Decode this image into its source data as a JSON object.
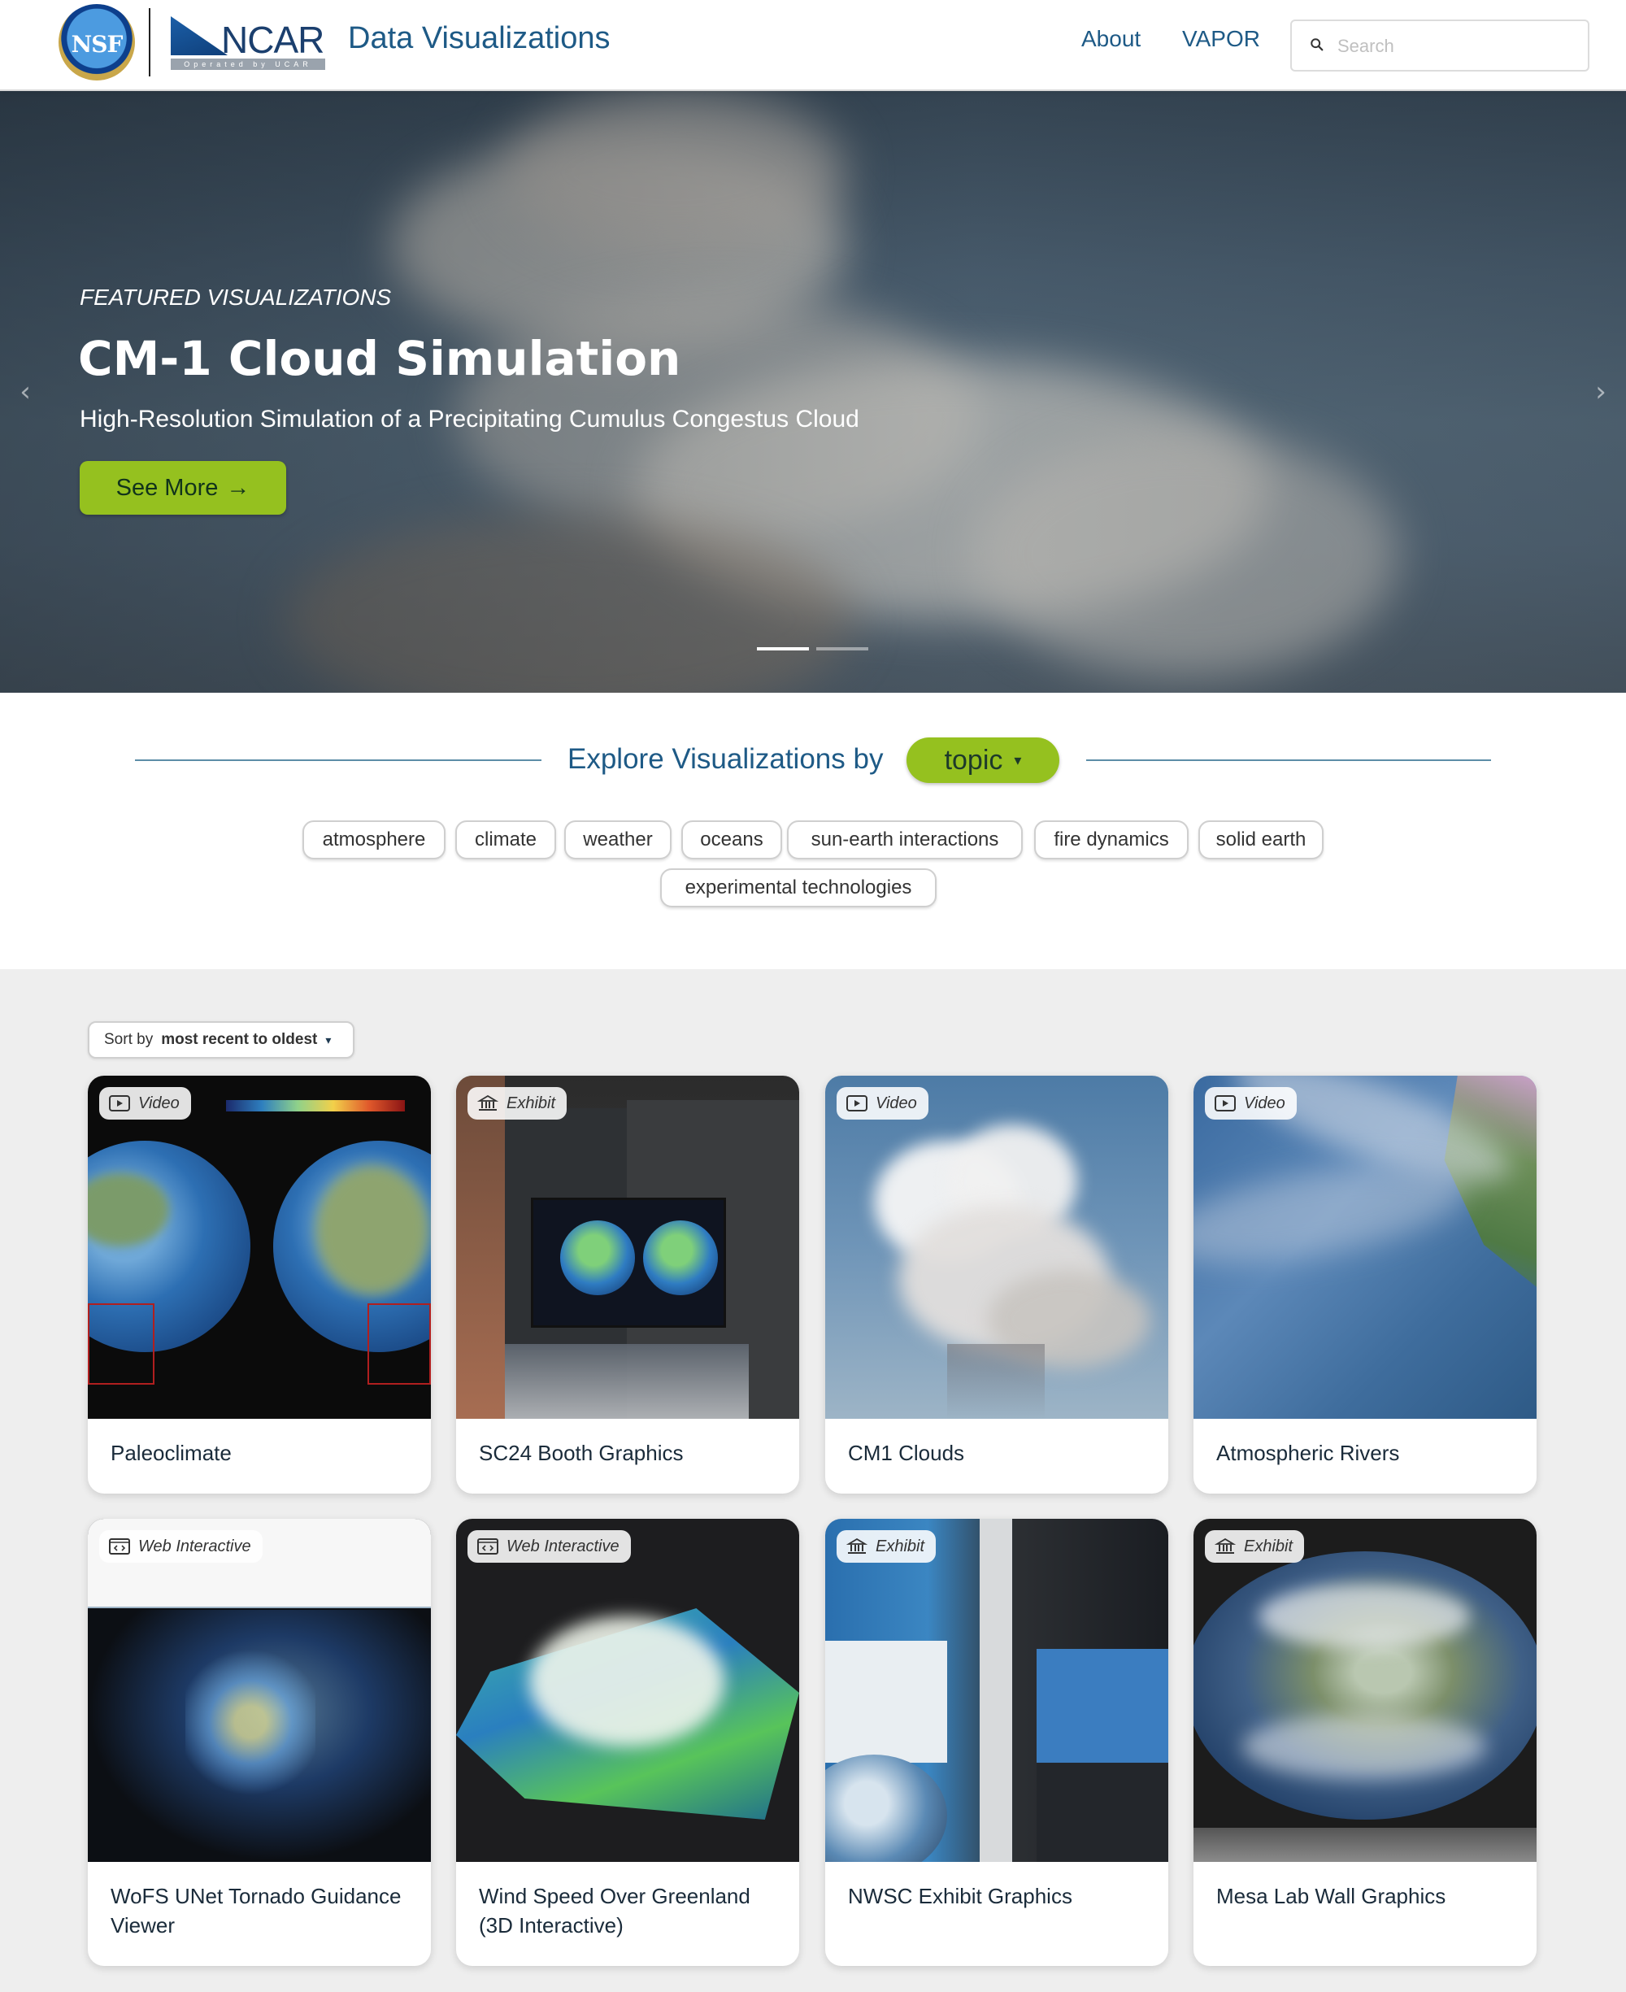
{
  "header": {
    "nsf_logo_text": "NSF",
    "ncar_logo_text": "NCAR",
    "ncar_logo_sub": "Operated by UCAR",
    "site_title": "Data Visualizations",
    "nav": [
      {
        "label": "About"
      },
      {
        "label": "VAPOR"
      }
    ],
    "search": {
      "placeholder": "Search",
      "value": ""
    }
  },
  "hero": {
    "label": "FEATURED VISUALIZATIONS",
    "title": "CM-1 Cloud Simulation",
    "subtitle": "High-Resolution Simulation of a Precipitating Cumulus Congestus Cloud",
    "button_label": "See More",
    "button_arrow": "→",
    "prev_arrow": "‹",
    "next_arrow": "›",
    "slide_count": 2,
    "active_slide": 1
  },
  "explore": {
    "label": "Explore Visualizations by",
    "filter_value": "topic",
    "filter_caret": "▾",
    "tags": [
      "atmosphere",
      "climate",
      "weather",
      "oceans",
      "sun-earth interactions",
      "fire dynamics",
      "solid earth",
      "experimental technologies"
    ]
  },
  "gallery": {
    "sort_label": "Sort by",
    "sort_value": "most recent to oldest",
    "sort_caret": "▾",
    "cards": [
      {
        "type": "Video",
        "icon": "play-icon",
        "title": "Paleoclimate"
      },
      {
        "type": "Exhibit",
        "icon": "museum-icon",
        "title": "SC24 Booth Graphics"
      },
      {
        "type": "Video",
        "icon": "play-icon",
        "title": "CM1 Clouds"
      },
      {
        "type": "Video",
        "icon": "play-icon",
        "title": "Atmospheric Rivers"
      },
      {
        "type": "Web Interactive",
        "icon": "code-icon",
        "title": "WoFS UNet Tornado Guidance Viewer"
      },
      {
        "type": "Web Interactive",
        "icon": "code-icon",
        "title": "Wind Speed Over Greenland (3D Interactive)"
      },
      {
        "type": "Exhibit",
        "icon": "museum-icon",
        "title": "NWSC Exhibit Graphics"
      },
      {
        "type": "Exhibit",
        "icon": "museum-icon",
        "title": "Mesa Lab Wall Graphics"
      }
    ]
  },
  "colors": {
    "accent_green": "#95c11f",
    "brand_blue": "#1e5a86",
    "gallery_bg": "#eeeeee"
  }
}
